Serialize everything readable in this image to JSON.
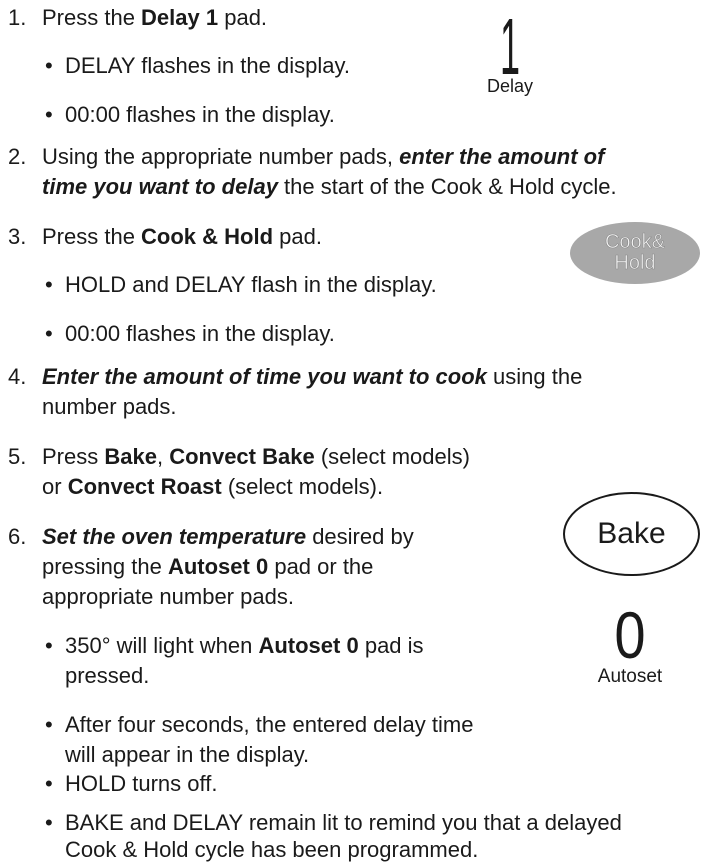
{
  "steps": {
    "s1": {
      "num": "1.",
      "pre": "Press the ",
      "b": "Delay 1",
      "post": " pad."
    },
    "s1a": "DELAY flashes in the display.",
    "s1b": "00:00 flashes in the display.",
    "s2": {
      "num": "2.",
      "line1_pre": "Using the appropriate number pads, ",
      "line1_bi": "enter the amount of",
      "line2_bi": "time you want to delay",
      "line2_post": " the start of the Cook & Hold cycle."
    },
    "s3": {
      "num": "3.",
      "pre": "Press the ",
      "b": "Cook & Hold",
      "post": " pad."
    },
    "s3a": "HOLD and DELAY flash in the display.",
    "s3b": "00:00 flashes in the display.",
    "s4": {
      "num": "4.",
      "line1_bi": "Enter the amount of time you want to cook",
      "line1_post": " using the",
      "line2": "number pads."
    },
    "s5": {
      "num": "5.",
      "pre": "Press ",
      "b1": "Bake",
      "mid1": ", ",
      "b2": "Convect Bake",
      "post1": " (select models)",
      "line2_pre": "or ",
      "b3": "Convect Roast",
      "line2_post": " (select models)."
    },
    "s6": {
      "num": "6.",
      "line1_bi": "Set the oven temperature",
      "line1_post": " desired by",
      "line2_pre": "pressing the ",
      "line2_b": "Autoset 0",
      "line2_post": " pad or the",
      "line3": "appropriate number pads."
    },
    "s6a": {
      "pre": "350° will light when ",
      "b": "Autoset 0",
      "post": " pad is",
      "line2": "pressed."
    },
    "s6b": {
      "line1": "After four seconds, the entered delay time",
      "line2": "will appear in the display."
    },
    "s6c": "HOLD turns off.",
    "s6d": {
      "line1": "BAKE and DELAY remain lit to remind you that a delayed",
      "line2": "Cook & Hold cycle has been programmed."
    },
    "bullet": "•"
  },
  "pads": {
    "delay": {
      "digit": "1",
      "label": "Delay"
    },
    "cook_hold": {
      "line1": "Cook&",
      "line2": "Hold"
    },
    "bake": {
      "label": "Bake"
    },
    "autoset": {
      "digit": "0",
      "label": "Autoset"
    }
  }
}
